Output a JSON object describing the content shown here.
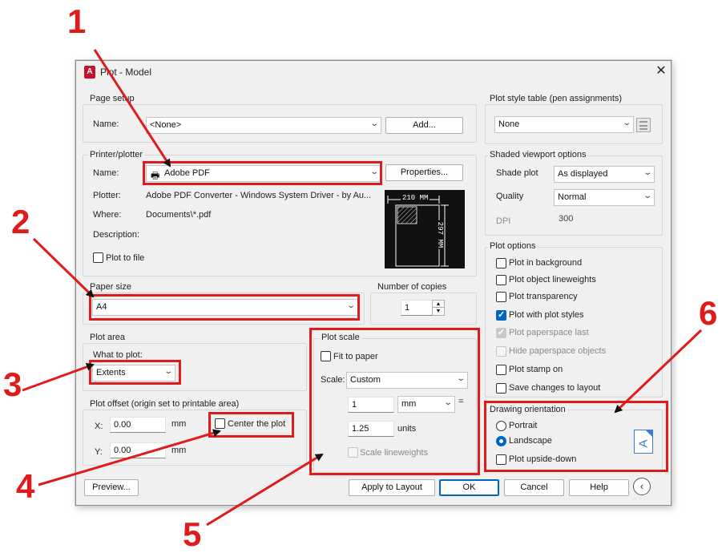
{
  "window": {
    "title": "Plot - Model",
    "app_icon_glyph": "A"
  },
  "page_setup": {
    "group": "Page setup",
    "name_label": "Name:",
    "name_value": "<None>",
    "add_button": "Add..."
  },
  "printer": {
    "group": "Printer/plotter",
    "name_label": "Name:",
    "name_value": "Adobe PDF",
    "properties_button": "Properties...",
    "plotter_label": "Plotter:",
    "plotter_value": "Adobe PDF Converter - Windows System Driver - by Au...",
    "where_label": "Where:",
    "where_value": "Documents\\*.pdf",
    "description_label": "Description:",
    "plot_to_file": "Plot to file",
    "preview_width": "210 MM",
    "preview_height": "297 MM"
  },
  "paper_size": {
    "group": "Paper size",
    "value": "A4"
  },
  "copies": {
    "group": "Number of copies",
    "value": "1"
  },
  "plot_area": {
    "group": "Plot area",
    "what_label": "What to plot:",
    "value": "Extents"
  },
  "plot_offset": {
    "group": "Plot offset (origin set to printable area)",
    "x_label": "X:",
    "x_value": "0.00",
    "x_unit": "mm",
    "y_label": "Y:",
    "y_value": "0.00",
    "y_unit": "mm",
    "center": "Center the plot"
  },
  "plot_scale": {
    "group": "Plot scale",
    "fit": "Fit to paper",
    "scale_label": "Scale:",
    "scale_value": "Custom",
    "num_value": "1",
    "unit_value": "mm",
    "equals": "=",
    "den_value": "1.25",
    "den_unit": "units",
    "lineweights": "Scale lineweights"
  },
  "plot_style_table": {
    "group": "Plot style table (pen assignments)",
    "value": "None"
  },
  "shaded": {
    "group": "Shaded viewport options",
    "shade_label": "Shade plot",
    "shade_value": "As displayed",
    "quality_label": "Quality",
    "quality_value": "Normal",
    "dpi_label": "DPI",
    "dpi_value": "300"
  },
  "plot_options": {
    "group": "Plot options",
    "items": [
      "Plot in background",
      "Plot object lineweights",
      "Plot transparency",
      "Plot with plot styles",
      "Plot paperspace last",
      "Hide paperspace objects",
      "Plot stamp on",
      "Save changes to layout"
    ]
  },
  "orientation": {
    "group": "Drawing orientation",
    "portrait": "Portrait",
    "landscape": "Landscape",
    "upside_down": "Plot upside-down",
    "icon_glyph": "A"
  },
  "buttons": {
    "preview": "Preview...",
    "apply": "Apply to Layout",
    "ok": "OK",
    "cancel": "Cancel",
    "help": "Help"
  },
  "callouts": [
    "1",
    "2",
    "3",
    "4",
    "5",
    "6"
  ],
  "colors": {
    "annotation": "#e01b1b",
    "accent": "#0067c0"
  }
}
